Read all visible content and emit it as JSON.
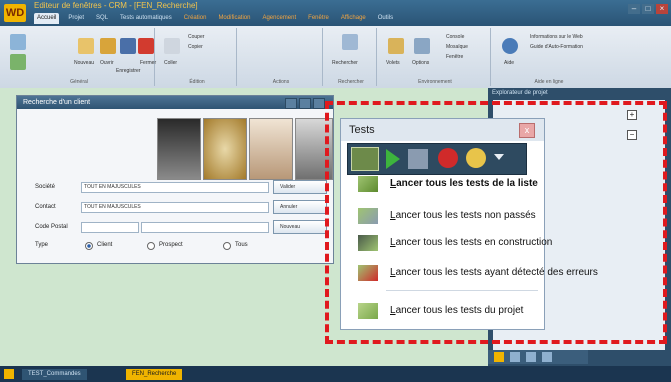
{
  "app": {
    "title": "Editeur de fenêtres - CRM - [FEN_Recherche]",
    "logo": "WD",
    "ribbon_tabs": [
      "Accueil",
      "Projet",
      "SQL",
      "Tests automatiques",
      "Création",
      "Modification",
      "Agencement",
      "Fenêtre",
      "Affichage",
      "Outils"
    ]
  },
  "ribbon": {
    "groups": [
      {
        "label": "Général",
        "items": [
          "Nouveau",
          "Ouvrir",
          "Enregistrer",
          "Fermer"
        ]
      },
      {
        "label": "Édition",
        "items": [
          "Couper",
          "Copier",
          "Coller"
        ]
      },
      {
        "label": "Actions",
        "items": []
      },
      {
        "label": "Rechercher",
        "items": [
          "Rechercher"
        ]
      },
      {
        "label": "Environnement",
        "items": [
          "Volets",
          "Options",
          "Console",
          "Mosaïque",
          "Fenêtre"
        ]
      },
      {
        "label": "Aide en ligne",
        "items": [
          "Aide",
          "Informations sur le Web",
          "Guide d'Auto-Formation"
        ]
      }
    ]
  },
  "form_window": {
    "title": "Recherche d'un client",
    "fields": [
      {
        "label": "Société",
        "value": "TOUT EN MAJUSCULES"
      },
      {
        "label": "Contact",
        "value": "TOUT EN MAJUSCULES"
      },
      {
        "label": "Code Postal",
        "value": ""
      }
    ],
    "type_label": "Type",
    "radio_options": [
      "Client",
      "Prospect",
      "Tous"
    ],
    "selected_radio": "Client",
    "buttons": [
      "Valider",
      "Annuler",
      "Nouveau"
    ]
  },
  "explorer": {
    "title": "Explorateur de projet"
  },
  "tests_popup": {
    "title": "Tests",
    "close": "x",
    "menu_items": [
      {
        "label": "Lancer tous les tests de la liste",
        "bold": true
      },
      {
        "label": "Lancer tous les tests non passés",
        "bold": false
      },
      {
        "label": "Lancer tous les tests en construction",
        "bold": false
      },
      {
        "label": "Lancer tous les tests ayant détecté des erreurs",
        "bold": false
      },
      {
        "label": "Lancer tous les tests du projet",
        "bold": false
      }
    ]
  },
  "status_tabs": [
    "TEST_Commandes",
    "FEN_Recherche"
  ],
  "colors": {
    "accent": "#f0b400",
    "dash": "#e0191e",
    "workspace": "#cfe6cf"
  }
}
